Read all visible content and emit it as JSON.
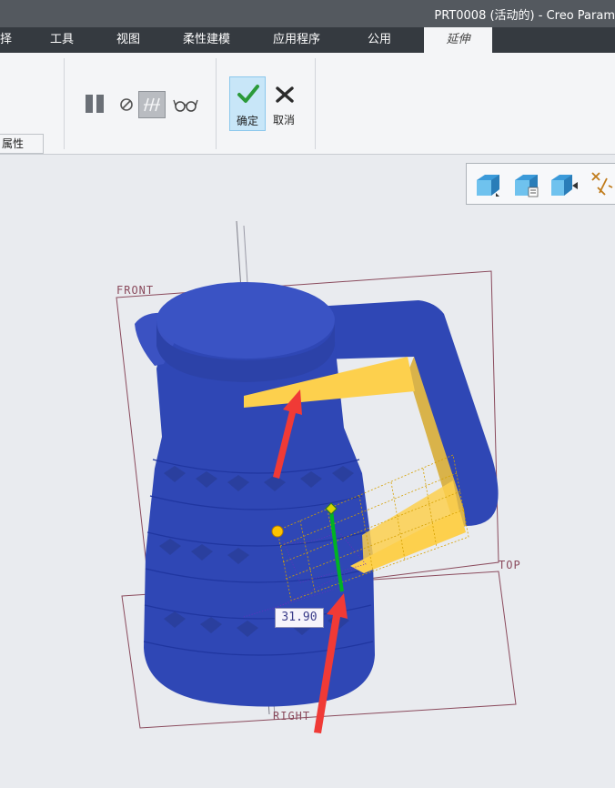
{
  "window": {
    "title": "PRT0008 (活动的) - Creo Param"
  },
  "tabs": [
    {
      "label": "择"
    },
    {
      "label": "工具"
    },
    {
      "label": "视图"
    },
    {
      "label": "柔性建模"
    },
    {
      "label": "应用程序"
    },
    {
      "label": "公用"
    },
    {
      "label": "延伸",
      "active": true
    }
  ],
  "ribbon": {
    "ok_label": "确定",
    "cancel_label": "取消",
    "properties_tab": "属性",
    "icons": [
      "pause-icon",
      "no-preview-icon",
      "verify-icon",
      "glasses-icon",
      "checkmark-icon",
      "close-icon"
    ]
  },
  "view_toolbar": {
    "icons": [
      "cube-icon",
      "saved-views-icon",
      "reorient-icon",
      "datum-display-icon"
    ]
  },
  "viewport": {
    "planes": {
      "front": "FRONT",
      "top": "TOP",
      "right": "RIGHT"
    },
    "dimension_value": "31.90",
    "colors": {
      "model": "#2f47b5",
      "surface": "#fdd04d",
      "edge_highlight": "#00b324",
      "arrow": "#f03a36",
      "datum": "#8a4a5c"
    }
  }
}
